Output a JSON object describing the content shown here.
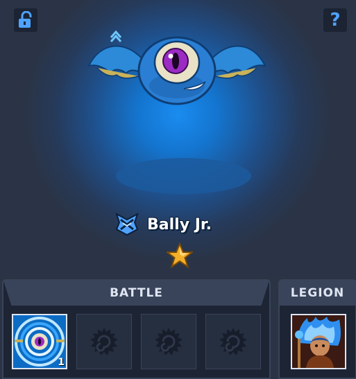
{
  "hero": {
    "name": "Bally Jr.",
    "stars": 1,
    "class_icon": "crossed-blades-shield-icon"
  },
  "battle_panel": {
    "title": "BATTLE",
    "slots": [
      {
        "state": "filled",
        "icon": "vortex-eye-skill-icon",
        "count": "1"
      },
      {
        "state": "empty",
        "icon": "locked-swirl-icon"
      },
      {
        "state": "empty",
        "icon": "locked-swirl-icon"
      },
      {
        "state": "empty",
        "icon": "locked-swirl-icon"
      }
    ]
  },
  "legion_panel": {
    "title": "LEGION",
    "icon": "blue-flame-warrior-portrait"
  },
  "controls": {
    "lock_icon": "unlock-icon",
    "help_label": "?"
  },
  "colors": {
    "background": "#2b3444",
    "glow": "#1a8cf0",
    "panel": "#1d2535",
    "panel_header": "#39445a",
    "accent_blue": "#4fa3ff"
  }
}
